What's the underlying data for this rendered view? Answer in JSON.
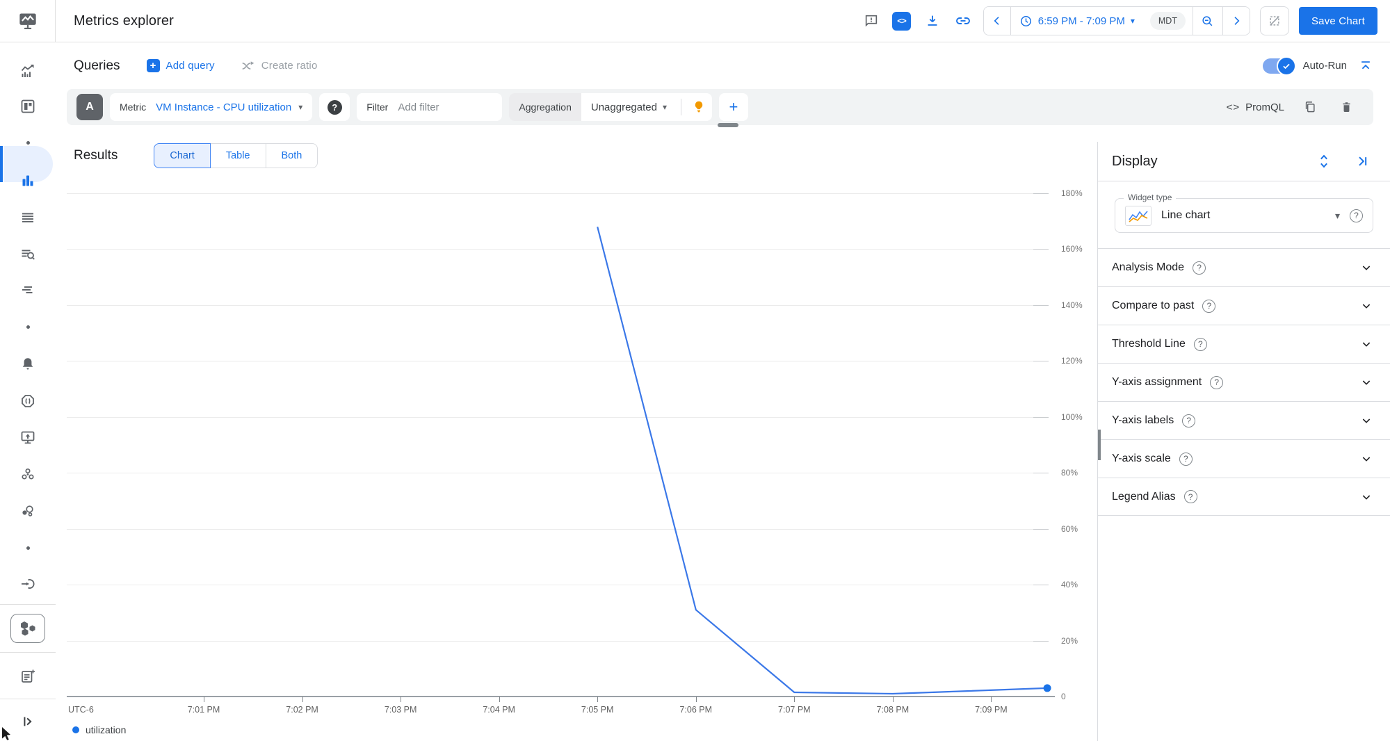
{
  "icons": {
    "caret_down": "▾",
    "plus": "+",
    "question": "?",
    "code": "<>",
    "exclamation": "!"
  },
  "header": {
    "title": "Metrics explorer",
    "time_range": "6:59 PM - 7:09 PM",
    "timezone": "MDT",
    "save_button": "Save Chart",
    "icon_names": [
      "feedback-icon",
      "code-toggle-icon",
      "download-icon",
      "link-icon",
      "chevron-left-icon",
      "clock-icon",
      "zoom-out-icon",
      "chevron-right-icon",
      "zoom-select-disabled-icon"
    ]
  },
  "queries_bar": {
    "title": "Queries",
    "add_query": "Add query",
    "create_ratio": "Create ratio",
    "auto_run": "Auto-Run"
  },
  "query": {
    "letter": "A",
    "metric_label": "Metric",
    "metric_value": "VM Instance - CPU utilization",
    "filter_label": "Filter",
    "filter_placeholder": "Add filter",
    "aggregation_label": "Aggregation",
    "aggregation_value": "Unaggregated",
    "promql_label": "PromQL"
  },
  "results": {
    "title": "Results",
    "tabs": [
      {
        "label": "Chart",
        "active": true
      },
      {
        "label": "Table",
        "active": false
      },
      {
        "label": "Both",
        "active": false
      }
    ]
  },
  "display": {
    "title": "Display",
    "widget_type_label": "Widget type",
    "widget_type_value": "Line chart",
    "sections": [
      "Analysis Mode",
      "Compare to past",
      "Threshold Line",
      "Y-axis assignment",
      "Y-axis labels",
      "Y-axis scale",
      "Legend Alias"
    ]
  },
  "sidebar": {
    "icon_names": [
      "metrics-trend-icon",
      "dashboards-icon",
      "nav-dot",
      "metrics-explorer-icon",
      "list-icon",
      "log-search-icon",
      "trace-icon",
      "nav-dot",
      "alerting-bell-icon",
      "incidents-icon",
      "uptime-check-icon",
      "groups-icon",
      "services-icon",
      "nav-dot",
      "integrations-icon",
      "kubernetes-hexagons-icon",
      "release-notes-icon",
      "expand-sidebar-icon"
    ]
  },
  "chart_data": {
    "type": "line",
    "title": "",
    "xlabel": "",
    "ylabel": "",
    "timezone_label": "UTC-6",
    "ylim": [
      0,
      180
    ],
    "grid": true,
    "legend_position": "bottom-left",
    "y_ticks": [
      {
        "value": 180,
        "label": "180%"
      },
      {
        "value": 160,
        "label": "160%"
      },
      {
        "value": 140,
        "label": "140%"
      },
      {
        "value": 120,
        "label": "120%"
      },
      {
        "value": 100,
        "label": "100%"
      },
      {
        "value": 80,
        "label": "80%"
      },
      {
        "value": 60,
        "label": "60%"
      },
      {
        "value": 40,
        "label": "40%"
      },
      {
        "value": 20,
        "label": "20%"
      },
      {
        "value": 0,
        "label": "0"
      }
    ],
    "x_ticks": [
      {
        "minute": 1,
        "label": "7:01 PM"
      },
      {
        "minute": 2,
        "label": "7:02 PM"
      },
      {
        "minute": 3,
        "label": "7:03 PM"
      },
      {
        "minute": 4,
        "label": "7:04 PM"
      },
      {
        "minute": 5,
        "label": "7:05 PM"
      },
      {
        "minute": 6,
        "label": "7:06 PM"
      },
      {
        "minute": 7,
        "label": "7:07 PM"
      },
      {
        "minute": 8,
        "label": "7:08 PM"
      },
      {
        "minute": 9,
        "label": "7:09 PM"
      }
    ],
    "series": [
      {
        "name": "utilization",
        "color": "#3b78e8",
        "end_dot": true,
        "points": [
          {
            "minute": 5.0,
            "value": 168
          },
          {
            "minute": 6.0,
            "value": 31
          },
          {
            "minute": 7.0,
            "value": 1.5
          },
          {
            "minute": 8.0,
            "value": 1.0
          },
          {
            "minute": 9.57,
            "value": 3.0
          }
        ]
      }
    ],
    "legend": [
      {
        "label": "utilization",
        "color": "#1a73e8"
      }
    ]
  }
}
